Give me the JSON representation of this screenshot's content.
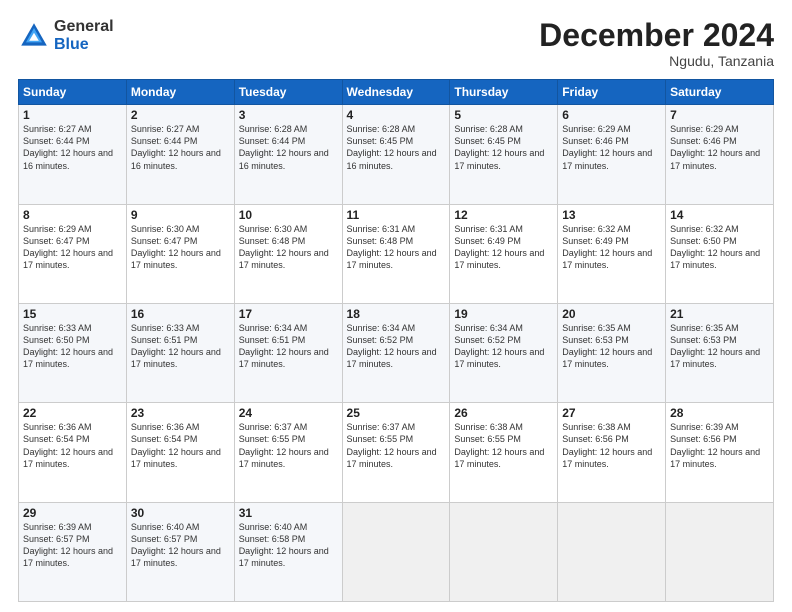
{
  "header": {
    "logo_general": "General",
    "logo_blue": "Blue",
    "month_title": "December 2024",
    "location": "Ngudu, Tanzania"
  },
  "days_of_week": [
    "Sunday",
    "Monday",
    "Tuesday",
    "Wednesday",
    "Thursday",
    "Friday",
    "Saturday"
  ],
  "weeks": [
    [
      {
        "day": 1,
        "sunrise": "6:27 AM",
        "sunset": "6:44 PM",
        "daylight": "12 hours and 16 minutes."
      },
      {
        "day": 2,
        "sunrise": "6:27 AM",
        "sunset": "6:44 PM",
        "daylight": "12 hours and 16 minutes."
      },
      {
        "day": 3,
        "sunrise": "6:28 AM",
        "sunset": "6:44 PM",
        "daylight": "12 hours and 16 minutes."
      },
      {
        "day": 4,
        "sunrise": "6:28 AM",
        "sunset": "6:45 PM",
        "daylight": "12 hours and 16 minutes."
      },
      {
        "day": 5,
        "sunrise": "6:28 AM",
        "sunset": "6:45 PM",
        "daylight": "12 hours and 17 minutes."
      },
      {
        "day": 6,
        "sunrise": "6:29 AM",
        "sunset": "6:46 PM",
        "daylight": "12 hours and 17 minutes."
      },
      {
        "day": 7,
        "sunrise": "6:29 AM",
        "sunset": "6:46 PM",
        "daylight": "12 hours and 17 minutes."
      }
    ],
    [
      {
        "day": 8,
        "sunrise": "6:29 AM",
        "sunset": "6:47 PM",
        "daylight": "12 hours and 17 minutes."
      },
      {
        "day": 9,
        "sunrise": "6:30 AM",
        "sunset": "6:47 PM",
        "daylight": "12 hours and 17 minutes."
      },
      {
        "day": 10,
        "sunrise": "6:30 AM",
        "sunset": "6:48 PM",
        "daylight": "12 hours and 17 minutes."
      },
      {
        "day": 11,
        "sunrise": "6:31 AM",
        "sunset": "6:48 PM",
        "daylight": "12 hours and 17 minutes."
      },
      {
        "day": 12,
        "sunrise": "6:31 AM",
        "sunset": "6:49 PM",
        "daylight": "12 hours and 17 minutes."
      },
      {
        "day": 13,
        "sunrise": "6:32 AM",
        "sunset": "6:49 PM",
        "daylight": "12 hours and 17 minutes."
      },
      {
        "day": 14,
        "sunrise": "6:32 AM",
        "sunset": "6:50 PM",
        "daylight": "12 hours and 17 minutes."
      }
    ],
    [
      {
        "day": 15,
        "sunrise": "6:33 AM",
        "sunset": "6:50 PM",
        "daylight": "12 hours and 17 minutes."
      },
      {
        "day": 16,
        "sunrise": "6:33 AM",
        "sunset": "6:51 PM",
        "daylight": "12 hours and 17 minutes."
      },
      {
        "day": 17,
        "sunrise": "6:34 AM",
        "sunset": "6:51 PM",
        "daylight": "12 hours and 17 minutes."
      },
      {
        "day": 18,
        "sunrise": "6:34 AM",
        "sunset": "6:52 PM",
        "daylight": "12 hours and 17 minutes."
      },
      {
        "day": 19,
        "sunrise": "6:34 AM",
        "sunset": "6:52 PM",
        "daylight": "12 hours and 17 minutes."
      },
      {
        "day": 20,
        "sunrise": "6:35 AM",
        "sunset": "6:53 PM",
        "daylight": "12 hours and 17 minutes."
      },
      {
        "day": 21,
        "sunrise": "6:35 AM",
        "sunset": "6:53 PM",
        "daylight": "12 hours and 17 minutes."
      }
    ],
    [
      {
        "day": 22,
        "sunrise": "6:36 AM",
        "sunset": "6:54 PM",
        "daylight": "12 hours and 17 minutes."
      },
      {
        "day": 23,
        "sunrise": "6:36 AM",
        "sunset": "6:54 PM",
        "daylight": "12 hours and 17 minutes."
      },
      {
        "day": 24,
        "sunrise": "6:37 AM",
        "sunset": "6:55 PM",
        "daylight": "12 hours and 17 minutes."
      },
      {
        "day": 25,
        "sunrise": "6:37 AM",
        "sunset": "6:55 PM",
        "daylight": "12 hours and 17 minutes."
      },
      {
        "day": 26,
        "sunrise": "6:38 AM",
        "sunset": "6:55 PM",
        "daylight": "12 hours and 17 minutes."
      },
      {
        "day": 27,
        "sunrise": "6:38 AM",
        "sunset": "6:56 PM",
        "daylight": "12 hours and 17 minutes."
      },
      {
        "day": 28,
        "sunrise": "6:39 AM",
        "sunset": "6:56 PM",
        "daylight": "12 hours and 17 minutes."
      }
    ],
    [
      {
        "day": 29,
        "sunrise": "6:39 AM",
        "sunset": "6:57 PM",
        "daylight": "12 hours and 17 minutes."
      },
      {
        "day": 30,
        "sunrise": "6:40 AM",
        "sunset": "6:57 PM",
        "daylight": "12 hours and 17 minutes."
      },
      {
        "day": 31,
        "sunrise": "6:40 AM",
        "sunset": "6:58 PM",
        "daylight": "12 hours and 17 minutes."
      },
      null,
      null,
      null,
      null
    ]
  ]
}
